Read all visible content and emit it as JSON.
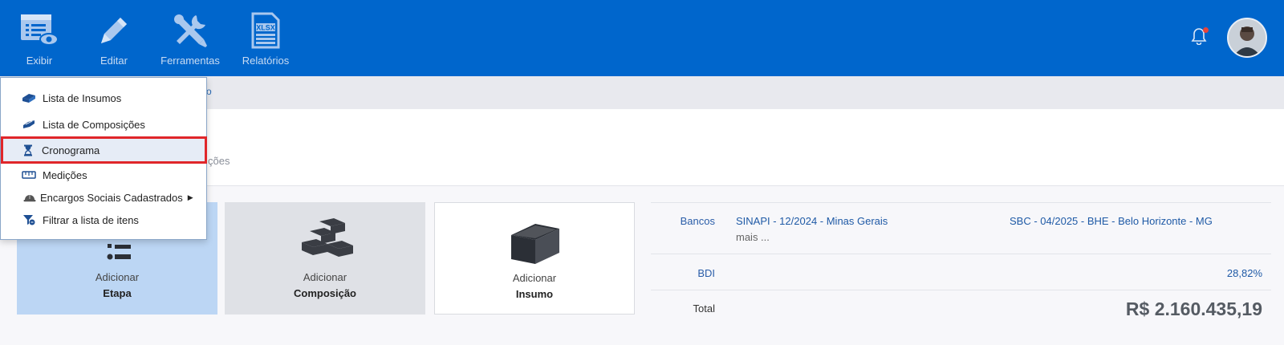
{
  "toolbar": {
    "items": [
      {
        "label": "Exibir",
        "icon": "exibir-icon"
      },
      {
        "label": "Editar",
        "icon": "pencil-icon"
      },
      {
        "label": "Ferramentas",
        "icon": "tools-icon"
      },
      {
        "label": "Relatórios",
        "icon": "xlsx-file-icon"
      }
    ],
    "xlsx_text": "XLSX"
  },
  "breadcrumb_fragment": "o",
  "tab_fragment": "ções",
  "menu": {
    "items": [
      {
        "label": "Lista de Insumos",
        "icon": "eraser-block-icon"
      },
      {
        "label": "Lista de Composições",
        "icon": "bricks-icon"
      },
      {
        "label": "Cronograma",
        "icon": "hourglass-icon",
        "active": true
      },
      {
        "label": "Medições",
        "icon": "ruler-icon"
      },
      {
        "label": "Encargos Sociais Cadastrados",
        "icon": "hard-hat-icon",
        "submenu": true
      },
      {
        "label": "Filtrar a lista de itens",
        "icon": "filter-icon"
      }
    ]
  },
  "cards": {
    "etapa": {
      "line1": "Adicionar",
      "line2": "Etapa"
    },
    "composicao": {
      "line1": "Adicionar",
      "line2": "Composição"
    },
    "insumo": {
      "line1": "Adicionar",
      "line2": "Insumo"
    }
  },
  "info": {
    "bancos_label": "Bancos",
    "banco1": "SINAPI - 12/2024 - Minas Gerais",
    "banco2": "SBC - 04/2025 - BHE - Belo Horizonte - MG",
    "mais": "mais ...",
    "bdi_label": "BDI",
    "bdi_value": "28,82%",
    "total_label": "Total",
    "total_value": "R$ 2.160.435,19"
  },
  "colors": {
    "topbar": "#0066cc",
    "active_outline": "#e0262a",
    "notification_dot": "#e8443a"
  }
}
